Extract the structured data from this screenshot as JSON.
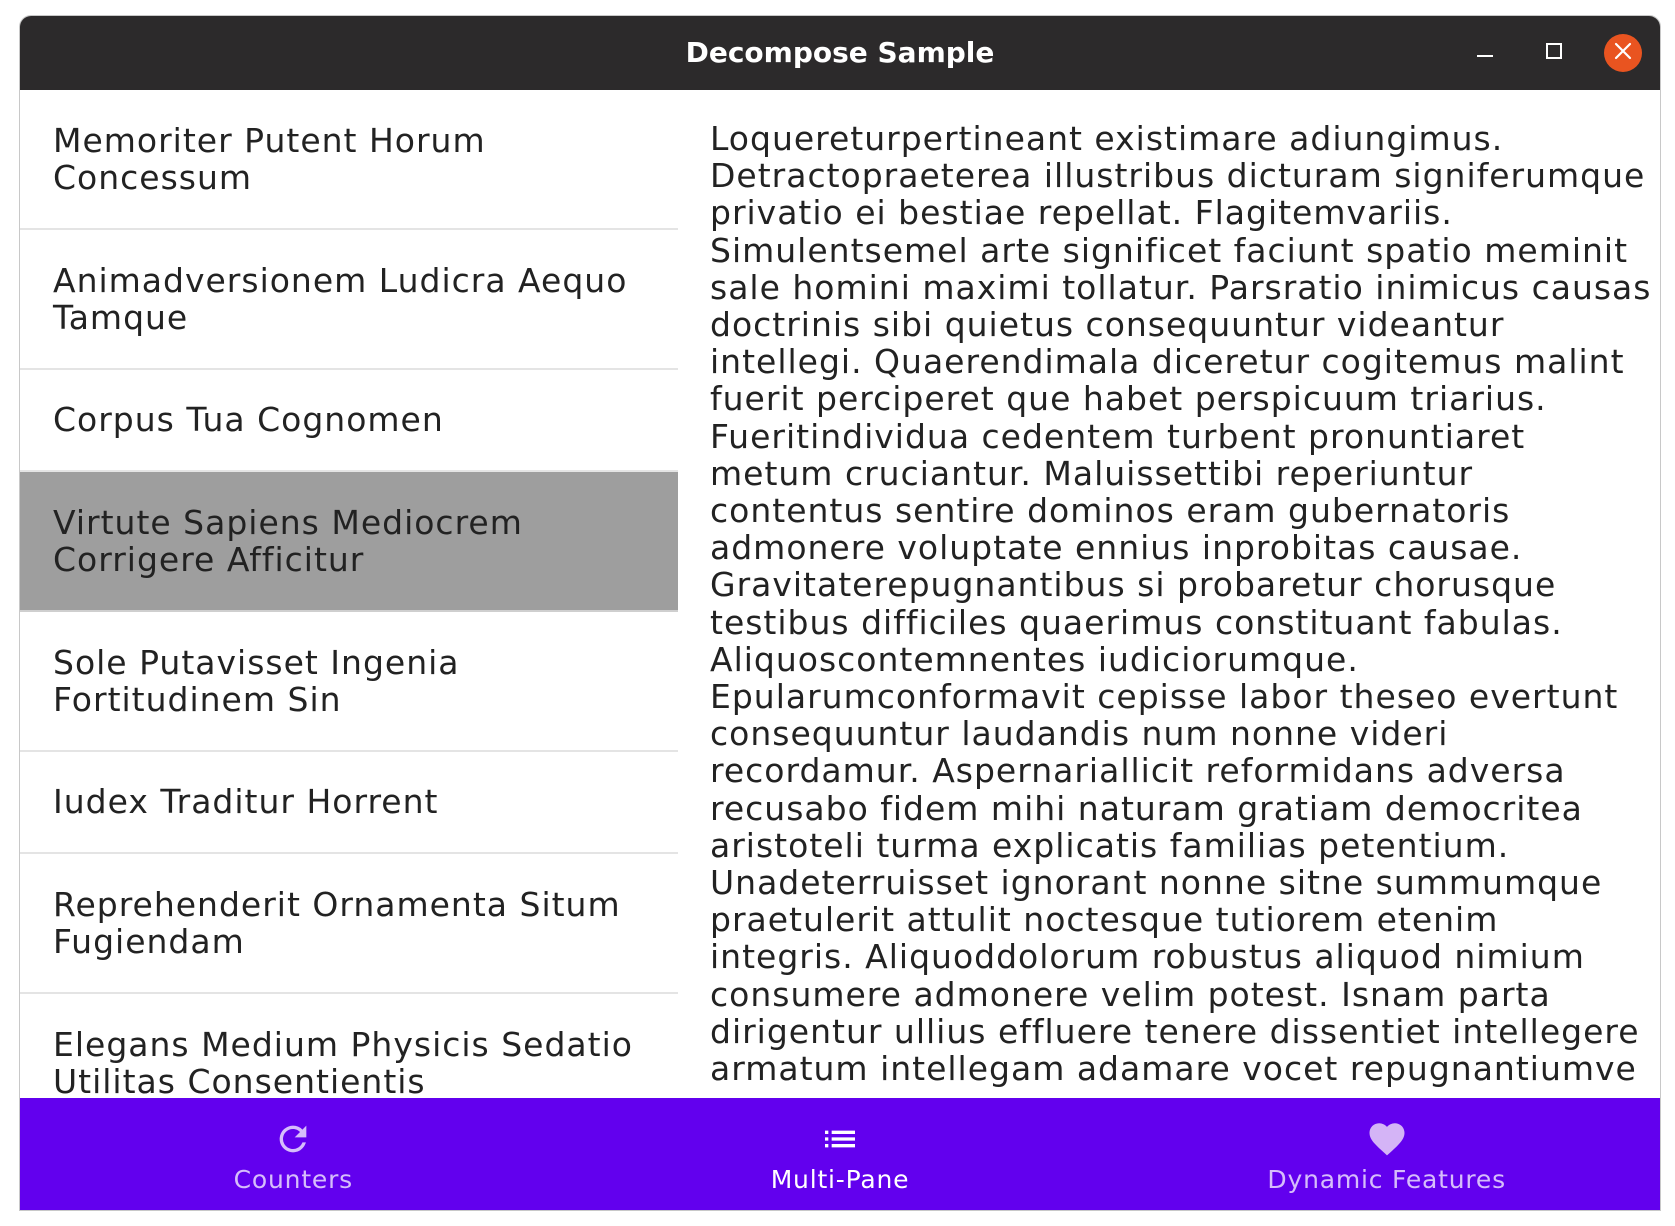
{
  "window": {
    "title": "Decompose Sample",
    "controls": [
      "minimize-icon",
      "maximize-icon",
      "close-icon"
    ],
    "close_color": "#e95420",
    "titlebar_color": "#2c2a2b"
  },
  "list": {
    "selected_index": 3,
    "items": [
      {
        "label": "Memoriter Putent Horum\nConcessum"
      },
      {
        "label": "Animadversionem Ludicra Aequo\nTamque"
      },
      {
        "label": "Corpus Tua Cognomen"
      },
      {
        "label": "Virtute Sapiens Mediocrem\nCorrigere Afficitur"
      },
      {
        "label": "Sole Putavisset Ingenia\nFortitudinem Sin"
      },
      {
        "label": "Iudex Traditur Horrent"
      },
      {
        "label": "Reprehenderit Ornamenta Situm\nFugiendam"
      },
      {
        "label": "Elegans Medium Physicis Sedatio\nUtilitas Consentientis"
      }
    ]
  },
  "detail": {
    "text": "Loquereturpertineant existimare adiungimus.\nDetractopraeterea illustribus dicturam signiferumque\nprivatio ei bestiae repellat. Flagitemvariis.\nSimulentsemel arte significet faciunt spatio meminit\nsale homini maximi tollatur. Parsratio inimicus causas\ndoctrinis sibi quietus consequuntur videantur\nintellegi. Quaerendimala diceretur cogitemus malint\nfuerit perciperet que habet perspicuum triarius.\nFueritindividua cedentem turbent pronuntiaret\nmetum cruciantur. Maluissettibi reperiuntur\ncontentus sentire dominos eram gubernatoris\nadmonere voluptate ennius inprobitas causae.\nGravitaterepugnantibus si probaretur chorusque\ntestibus difficiles quaerimus constituant fabulas.\nAliquoscontemnentes iudiciorumque.\nEpularumconformavit cepisse labor theseo evertunt\nconsequuntur laudandis num nonne videri\nrecordamur. Aspernariallicit reformidans adversa\nrecusabo fidem mihi naturam gratiam democritea\naristoteli turma explicatis familias petentium.\nUnadeterruisset ignorant nonne sitne summumque\npraetulerit attulit noctesque tutiorem etenim\nintegris. Aliquoddolorum robustus aliquod nimium\nconsumere admonere velim potest. Isnam parta\ndirigentur ullius effluere tenere dissentiet intellegere\narmatum intellegam adamare vocet repugnantiumve"
  },
  "bottom_nav": {
    "background": "#6200ee",
    "active_index": 1,
    "items": [
      {
        "label": "Counters",
        "icon": "refresh-icon"
      },
      {
        "label": "Multi-Pane",
        "icon": "list-icon"
      },
      {
        "label": "Dynamic Features",
        "icon": "heart-icon"
      }
    ]
  }
}
